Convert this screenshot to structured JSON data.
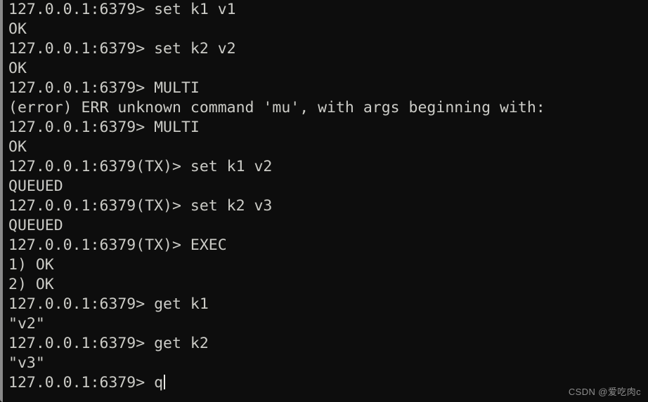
{
  "window": {
    "app": "redis-cli",
    "background_color": "#0d0d0d",
    "text_color": "#ccccc7",
    "edge_color": "#8a8a8a"
  },
  "terminal": {
    "prompt": "127.0.0.1:6379>",
    "tx_prompt": "127.0.0.1:6379(TX)>",
    "lines": [
      {
        "id": "line-1",
        "text": "127.0.0.1:6379> set k1 v1",
        "kind": "prompt-command"
      },
      {
        "id": "line-2",
        "text": "OK",
        "kind": "reply-status"
      },
      {
        "id": "line-3",
        "text": "127.0.0.1:6379> set k2 v2",
        "kind": "prompt-command"
      },
      {
        "id": "line-4",
        "text": "OK",
        "kind": "reply-status"
      },
      {
        "id": "line-5",
        "text": "127.0.0.1:6379> MULTI",
        "kind": "prompt-command"
      },
      {
        "id": "line-6",
        "text": "(error) ERR unknown command 'mu', with args beginning with:",
        "kind": "reply-error"
      },
      {
        "id": "line-7",
        "text": "127.0.0.1:6379> MULTI",
        "kind": "prompt-command"
      },
      {
        "id": "line-8",
        "text": "OK",
        "kind": "reply-status"
      },
      {
        "id": "line-9",
        "text": "127.0.0.1:6379(TX)> set k1 v2",
        "kind": "prompt-command-tx"
      },
      {
        "id": "line-10",
        "text": "QUEUED",
        "kind": "reply-status"
      },
      {
        "id": "line-11",
        "text": "127.0.0.1:6379(TX)> set k2 v3",
        "kind": "prompt-command-tx"
      },
      {
        "id": "line-12",
        "text": "QUEUED",
        "kind": "reply-status"
      },
      {
        "id": "line-13",
        "text": "127.0.0.1:6379(TX)> EXEC",
        "kind": "prompt-command-tx"
      },
      {
        "id": "line-14",
        "text": "1) OK",
        "kind": "reply-array-item"
      },
      {
        "id": "line-15",
        "text": "2) OK",
        "kind": "reply-array-item"
      },
      {
        "id": "line-16",
        "text": "127.0.0.1:6379> get k1",
        "kind": "prompt-command"
      },
      {
        "id": "line-17",
        "text": "\"v2\"",
        "kind": "reply-bulk-string"
      },
      {
        "id": "line-18",
        "text": "127.0.0.1:6379> get k2",
        "kind": "prompt-command"
      },
      {
        "id": "line-19",
        "text": "\"v3\"",
        "kind": "reply-bulk-string"
      },
      {
        "id": "line-20",
        "text": "127.0.0.1:6379> q",
        "kind": "prompt-current",
        "cursor": true
      }
    ]
  },
  "watermark": {
    "text": "CSDN @爱吃肉c"
  }
}
